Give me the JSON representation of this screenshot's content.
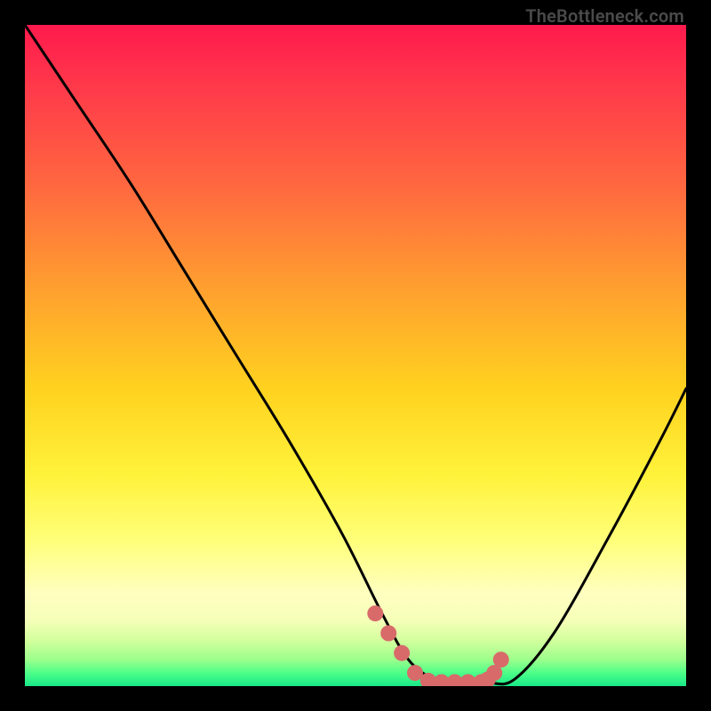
{
  "watermark": "TheBottleneck.com",
  "chart_data": {
    "type": "line",
    "title": "",
    "xlabel": "",
    "ylabel": "",
    "xlim": [
      0,
      100
    ],
    "ylim": [
      0,
      100
    ],
    "series": [
      {
        "name": "bottleneck-curve",
        "x": [
          0,
          8,
          16,
          24,
          32,
          40,
          48,
          54,
          58,
          62,
          66,
          70,
          74,
          80,
          88,
          96,
          100
        ],
        "values": [
          100,
          88,
          76,
          63,
          50,
          37,
          23,
          11,
          4,
          1,
          0.5,
          0.5,
          1,
          8,
          22,
          37,
          45
        ]
      }
    ],
    "highlight": {
      "name": "optimal-range-dots",
      "color": "#d86a6a",
      "x": [
        53,
        55,
        57,
        59,
        61,
        63,
        65,
        67,
        69,
        70,
        71,
        72
      ],
      "values": [
        11,
        8,
        5,
        2,
        0.8,
        0.6,
        0.6,
        0.6,
        0.6,
        1,
        2,
        4
      ]
    }
  }
}
